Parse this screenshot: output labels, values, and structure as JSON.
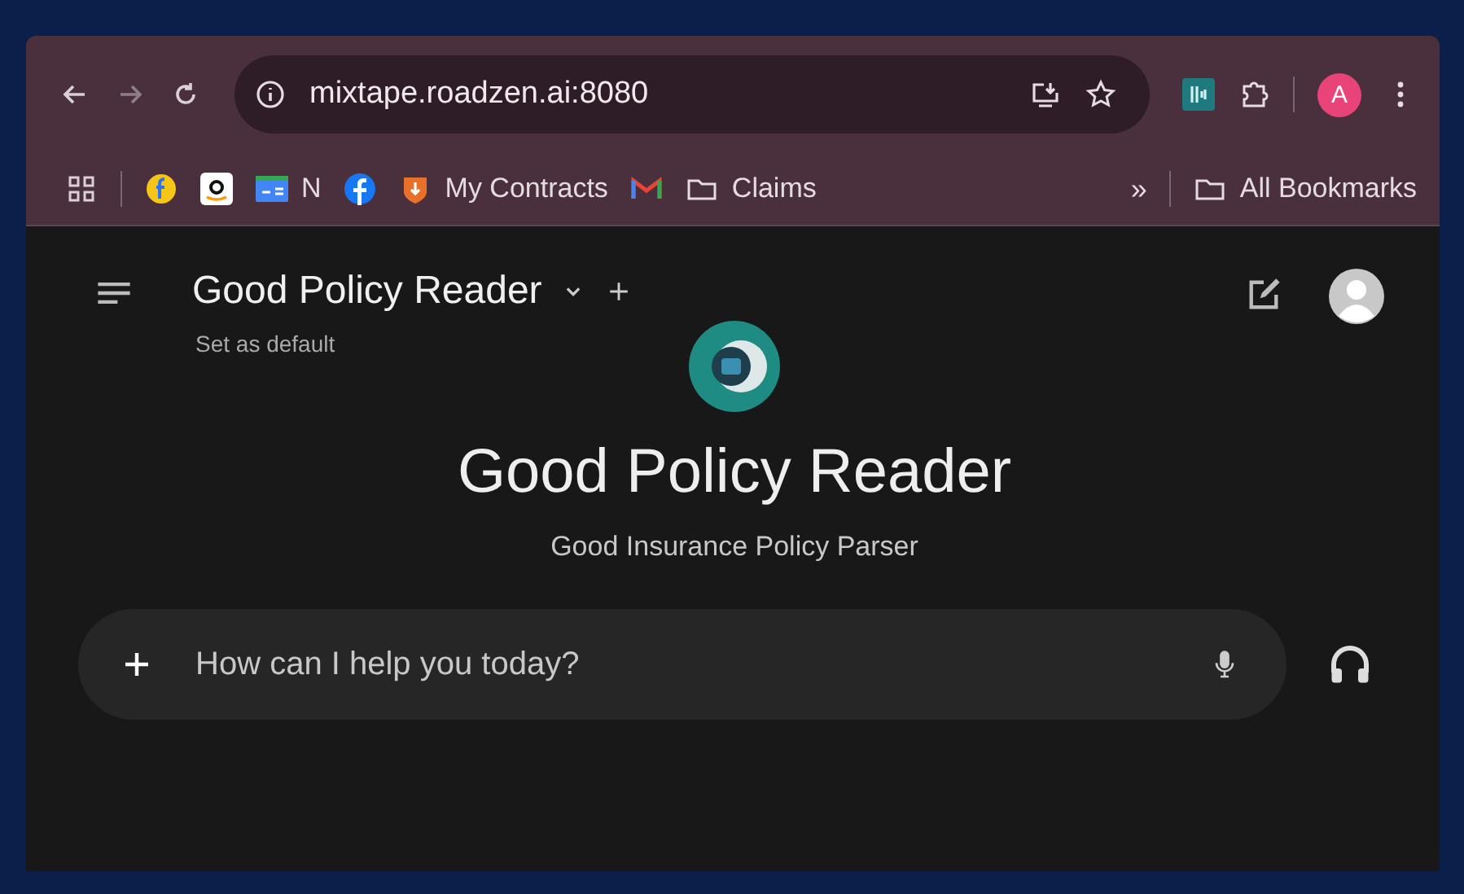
{
  "browser": {
    "url": "mixtape.roadzen.ai:8080",
    "profile_initial": "A",
    "bookmarks": [
      {
        "kind": "apps"
      },
      {
        "kind": "flipkart"
      },
      {
        "kind": "amazon"
      },
      {
        "kind": "news",
        "label": "N"
      },
      {
        "kind": "facebook"
      },
      {
        "kind": "contracts",
        "label": "My Contracts"
      },
      {
        "kind": "gmail"
      },
      {
        "kind": "folder",
        "label": "Claims"
      }
    ],
    "overflow": "»",
    "all_bookmarks": "All Bookmarks"
  },
  "app": {
    "title": "Good Policy Reader",
    "set_default": "Set as default",
    "heading": "Good Policy Reader",
    "subtitle": "Good Insurance Policy Parser",
    "input": {
      "placeholder": "How can I help you today?"
    }
  }
}
